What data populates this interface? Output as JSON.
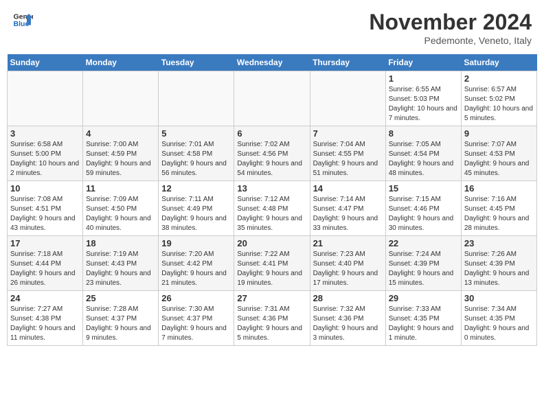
{
  "header": {
    "logo_line1": "General",
    "logo_line2": "Blue",
    "month_year": "November 2024",
    "location": "Pedemonte, Veneto, Italy"
  },
  "days_of_week": [
    "Sunday",
    "Monday",
    "Tuesday",
    "Wednesday",
    "Thursday",
    "Friday",
    "Saturday"
  ],
  "weeks": [
    [
      {
        "day": "",
        "info": ""
      },
      {
        "day": "",
        "info": ""
      },
      {
        "day": "",
        "info": ""
      },
      {
        "day": "",
        "info": ""
      },
      {
        "day": "",
        "info": ""
      },
      {
        "day": "1",
        "info": "Sunrise: 6:55 AM\nSunset: 5:03 PM\nDaylight: 10 hours and 7 minutes."
      },
      {
        "day": "2",
        "info": "Sunrise: 6:57 AM\nSunset: 5:02 PM\nDaylight: 10 hours and 5 minutes."
      }
    ],
    [
      {
        "day": "3",
        "info": "Sunrise: 6:58 AM\nSunset: 5:00 PM\nDaylight: 10 hours and 2 minutes."
      },
      {
        "day": "4",
        "info": "Sunrise: 7:00 AM\nSunset: 4:59 PM\nDaylight: 9 hours and 59 minutes."
      },
      {
        "day": "5",
        "info": "Sunrise: 7:01 AM\nSunset: 4:58 PM\nDaylight: 9 hours and 56 minutes."
      },
      {
        "day": "6",
        "info": "Sunrise: 7:02 AM\nSunset: 4:56 PM\nDaylight: 9 hours and 54 minutes."
      },
      {
        "day": "7",
        "info": "Sunrise: 7:04 AM\nSunset: 4:55 PM\nDaylight: 9 hours and 51 minutes."
      },
      {
        "day": "8",
        "info": "Sunrise: 7:05 AM\nSunset: 4:54 PM\nDaylight: 9 hours and 48 minutes."
      },
      {
        "day": "9",
        "info": "Sunrise: 7:07 AM\nSunset: 4:53 PM\nDaylight: 9 hours and 45 minutes."
      }
    ],
    [
      {
        "day": "10",
        "info": "Sunrise: 7:08 AM\nSunset: 4:51 PM\nDaylight: 9 hours and 43 minutes."
      },
      {
        "day": "11",
        "info": "Sunrise: 7:09 AM\nSunset: 4:50 PM\nDaylight: 9 hours and 40 minutes."
      },
      {
        "day": "12",
        "info": "Sunrise: 7:11 AM\nSunset: 4:49 PM\nDaylight: 9 hours and 38 minutes."
      },
      {
        "day": "13",
        "info": "Sunrise: 7:12 AM\nSunset: 4:48 PM\nDaylight: 9 hours and 35 minutes."
      },
      {
        "day": "14",
        "info": "Sunrise: 7:14 AM\nSunset: 4:47 PM\nDaylight: 9 hours and 33 minutes."
      },
      {
        "day": "15",
        "info": "Sunrise: 7:15 AM\nSunset: 4:46 PM\nDaylight: 9 hours and 30 minutes."
      },
      {
        "day": "16",
        "info": "Sunrise: 7:16 AM\nSunset: 4:45 PM\nDaylight: 9 hours and 28 minutes."
      }
    ],
    [
      {
        "day": "17",
        "info": "Sunrise: 7:18 AM\nSunset: 4:44 PM\nDaylight: 9 hours and 26 minutes."
      },
      {
        "day": "18",
        "info": "Sunrise: 7:19 AM\nSunset: 4:43 PM\nDaylight: 9 hours and 23 minutes."
      },
      {
        "day": "19",
        "info": "Sunrise: 7:20 AM\nSunset: 4:42 PM\nDaylight: 9 hours and 21 minutes."
      },
      {
        "day": "20",
        "info": "Sunrise: 7:22 AM\nSunset: 4:41 PM\nDaylight: 9 hours and 19 minutes."
      },
      {
        "day": "21",
        "info": "Sunrise: 7:23 AM\nSunset: 4:40 PM\nDaylight: 9 hours and 17 minutes."
      },
      {
        "day": "22",
        "info": "Sunrise: 7:24 AM\nSunset: 4:39 PM\nDaylight: 9 hours and 15 minutes."
      },
      {
        "day": "23",
        "info": "Sunrise: 7:26 AM\nSunset: 4:39 PM\nDaylight: 9 hours and 13 minutes."
      }
    ],
    [
      {
        "day": "24",
        "info": "Sunrise: 7:27 AM\nSunset: 4:38 PM\nDaylight: 9 hours and 11 minutes."
      },
      {
        "day": "25",
        "info": "Sunrise: 7:28 AM\nSunset: 4:37 PM\nDaylight: 9 hours and 9 minutes."
      },
      {
        "day": "26",
        "info": "Sunrise: 7:30 AM\nSunset: 4:37 PM\nDaylight: 9 hours and 7 minutes."
      },
      {
        "day": "27",
        "info": "Sunrise: 7:31 AM\nSunset: 4:36 PM\nDaylight: 9 hours and 5 minutes."
      },
      {
        "day": "28",
        "info": "Sunrise: 7:32 AM\nSunset: 4:36 PM\nDaylight: 9 hours and 3 minutes."
      },
      {
        "day": "29",
        "info": "Sunrise: 7:33 AM\nSunset: 4:35 PM\nDaylight: 9 hours and 1 minute."
      },
      {
        "day": "30",
        "info": "Sunrise: 7:34 AM\nSunset: 4:35 PM\nDaylight: 9 hours and 0 minutes."
      }
    ]
  ]
}
